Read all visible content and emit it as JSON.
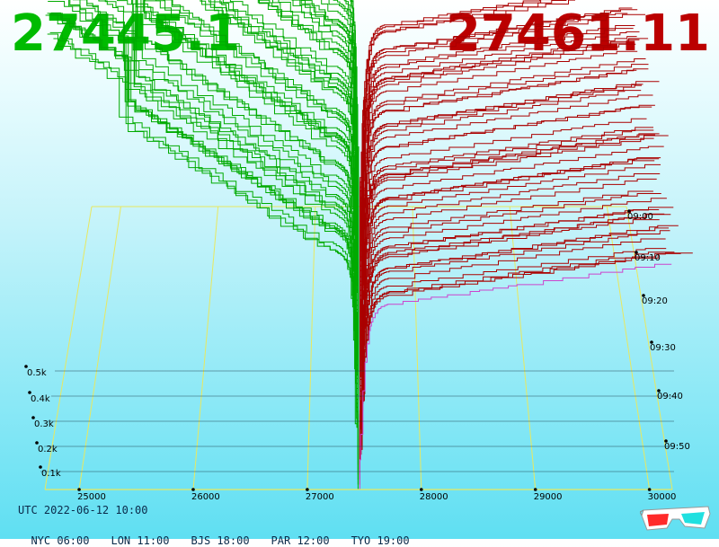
{
  "header": {
    "bid_price": "27445.1",
    "ask_price": "27461.11",
    "bid_color": "#00bb00",
    "ask_color": "#bb0000"
  },
  "footer": {
    "utc": "UTC 2022-06-12 10:00",
    "zones": [
      "NYC 06:00",
      "LON 11:00",
      "BJS 18:00",
      "PAR 12:00",
      "TYO 19:00"
    ],
    "glasses_icon": "3d-glasses-icon"
  },
  "chart_data": {
    "type": "area",
    "x_ticks": [
      "25000",
      "26000",
      "27000",
      "28000",
      "29000",
      "30000"
    ],
    "x_tick_values": [
      25000,
      26000,
      27000,
      28000,
      29000,
      30000
    ],
    "xlim": [
      24700,
      30200
    ],
    "depth_ticks": [
      "0.1k",
      "0.2k",
      "0.3k",
      "0.4k",
      "0.5k"
    ],
    "depth_tick_values": [
      100,
      200,
      300,
      400,
      500
    ],
    "time_ticks": [
      "09:00",
      "09:10",
      "09:20",
      "09:30",
      "09:40",
      "09:50"
    ],
    "mid_price": 27453,
    "series": [
      {
        "side": "bid",
        "color": "#00aa00",
        "snapshots": 58
      },
      {
        "side": "ask",
        "color": "#aa0000",
        "snapshots": 58
      }
    ],
    "latest_ask_color": "#cc44cc",
    "grid": true
  }
}
